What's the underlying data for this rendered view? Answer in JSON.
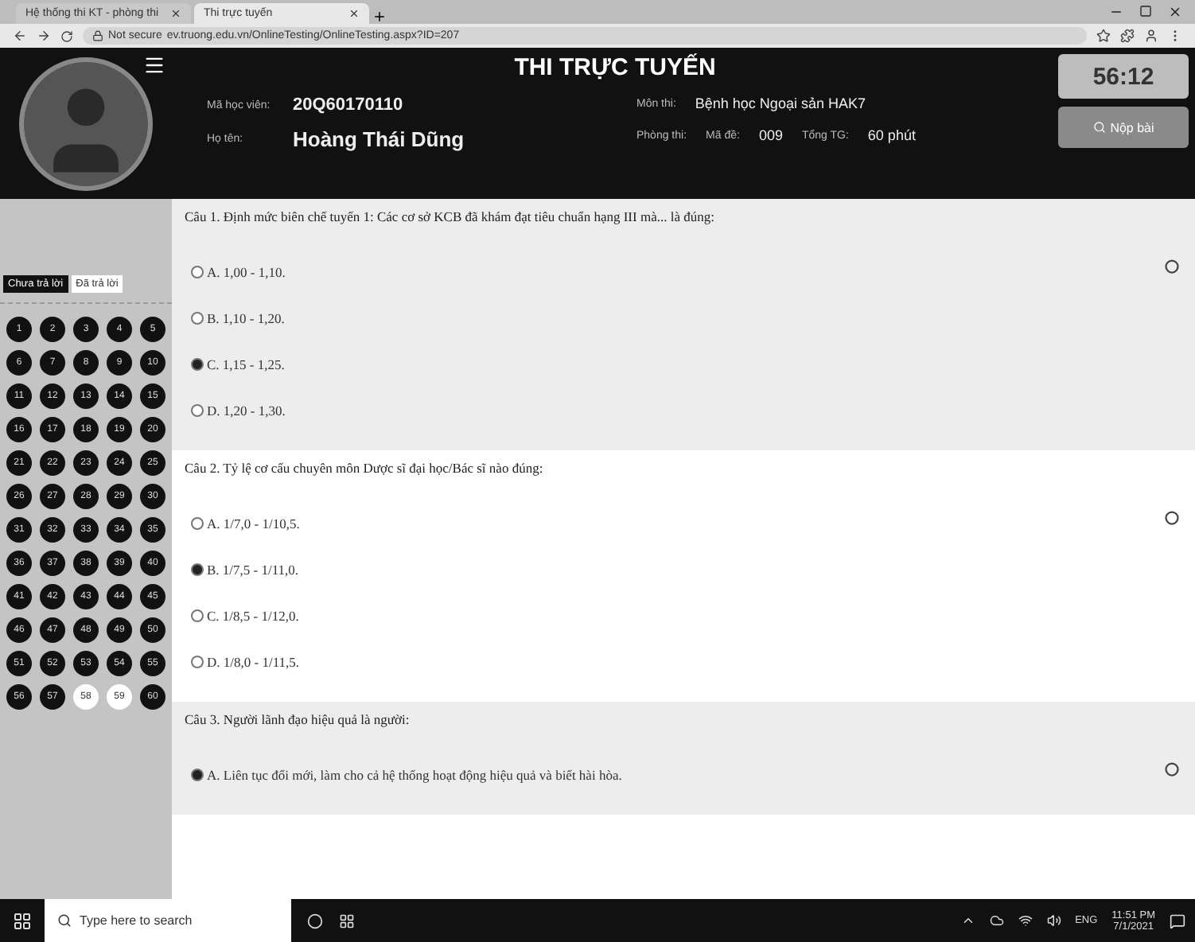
{
  "browser": {
    "tabs": [
      {
        "label": "Hệ thống thi KT - phòng thi",
        "selected": false
      },
      {
        "label": "Thi trực tuyến",
        "selected": true
      }
    ],
    "security": "Not secure",
    "url": "ev.truong.edu.vn/OnlineTesting/OnlineTesting.aspx?ID=207"
  },
  "header": {
    "title": "THI TRỰC TUYẾN",
    "fields": [
      {
        "label": "Mã học viên:",
        "value": "20Q60170110"
      },
      {
        "label": "Họ tên:",
        "value": "Hoàng Thái Dũng"
      }
    ],
    "exam": {
      "subject_label": "Môn thi:",
      "subject": "Bệnh học Ngoại sản HAK7",
      "room_label": "Phòng thi:",
      "code_label": "Mã đề:",
      "code": "009",
      "time_label": "Tổng TG:",
      "time": "60 phút"
    },
    "timer": "56:12",
    "submit": "Nộp bài"
  },
  "sidebar": {
    "tabs": [
      {
        "label": "Chưa trả lời",
        "selected": true
      },
      {
        "label": "Đã trả lời",
        "selected": false
      }
    ],
    "questions": [
      {
        "label": "1",
        "answered": true
      },
      {
        "label": "2",
        "answered": true
      },
      {
        "label": "3",
        "answered": true
      },
      {
        "label": "4",
        "answered": true
      },
      {
        "label": "5",
        "answered": true
      },
      {
        "label": "6",
        "answered": true
      },
      {
        "label": "7",
        "answered": true
      },
      {
        "label": "8",
        "answered": true
      },
      {
        "label": "9",
        "answered": true
      },
      {
        "label": "10",
        "answered": true
      },
      {
        "label": "11",
        "answered": true
      },
      {
        "label": "12",
        "answered": true
      },
      {
        "label": "13",
        "answered": true
      },
      {
        "label": "14",
        "answered": true
      },
      {
        "label": "15",
        "answered": true
      },
      {
        "label": "16",
        "answered": true
      },
      {
        "label": "17",
        "answered": true
      },
      {
        "label": "18",
        "answered": true
      },
      {
        "label": "19",
        "answered": true
      },
      {
        "label": "20",
        "answered": true
      },
      {
        "label": "21",
        "answered": true
      },
      {
        "label": "22",
        "answered": true
      },
      {
        "label": "23",
        "answered": true
      },
      {
        "label": "24",
        "answered": true
      },
      {
        "label": "25",
        "answered": true
      },
      {
        "label": "26",
        "answered": true
      },
      {
        "label": "27",
        "answered": true
      },
      {
        "label": "28",
        "answered": true
      },
      {
        "label": "29",
        "answered": true
      },
      {
        "label": "30",
        "answered": true
      },
      {
        "label": "31",
        "answered": true
      },
      {
        "label": "32",
        "answered": true
      },
      {
        "label": "33",
        "answered": true
      },
      {
        "label": "34",
        "answered": true
      },
      {
        "label": "35",
        "answered": true
      },
      {
        "label": "36",
        "answered": true
      },
      {
        "label": "37",
        "answered": true
      },
      {
        "label": "38",
        "answered": true
      },
      {
        "label": "39",
        "answered": true
      },
      {
        "label": "40",
        "answered": true
      },
      {
        "label": "41",
        "answered": true
      },
      {
        "label": "42",
        "answered": true
      },
      {
        "label": "43",
        "answered": true
      },
      {
        "label": "44",
        "answered": true
      },
      {
        "label": "45",
        "answered": true
      },
      {
        "label": "46",
        "answered": true
      },
      {
        "label": "47",
        "answered": true
      },
      {
        "label": "48",
        "answered": true
      },
      {
        "label": "49",
        "answered": true
      },
      {
        "label": "50",
        "answered": true
      },
      {
        "label": "51",
        "answered": true
      },
      {
        "label": "52",
        "answered": true
      },
      {
        "label": "53",
        "answered": true
      },
      {
        "label": "54",
        "answered": true
      },
      {
        "label": "55",
        "answered": true
      },
      {
        "label": "56",
        "answered": true
      },
      {
        "label": "57",
        "answered": true
      },
      {
        "label": "58",
        "answered": false
      },
      {
        "label": "59",
        "answered": false
      },
      {
        "label": "60",
        "answered": true
      }
    ]
  },
  "questions": [
    {
      "text": "Câu 1. Định mức biên chế tuyến 1: Các cơ sở KCB đã khám đạt tiêu chuẩn hạng III mà... là đúng:",
      "options": [
        {
          "label": "A. 1,00 - 1,10.",
          "selected": false
        },
        {
          "label": "B. 1,10 - 1,20.",
          "selected": false
        },
        {
          "label": "C. 1,15 - 1,25.",
          "selected": true
        },
        {
          "label": "D. 1,20 - 1,30.",
          "selected": false
        }
      ]
    },
    {
      "text": "Câu 2. Tỷ lệ cơ cấu chuyên môn Dược sĩ đại học/Bác sĩ nào đúng:",
      "options": [
        {
          "label": "A. 1/7,0 - 1/10,5.",
          "selected": false
        },
        {
          "label": "B. 1/7,5 - 1/11,0.",
          "selected": true
        },
        {
          "label": "C. 1/8,5 - 1/12,0.",
          "selected": false
        },
        {
          "label": "D. 1/8,0 - 1/11,5.",
          "selected": false
        }
      ]
    },
    {
      "text": "Câu 3. Người lãnh đạo hiệu quả là người:",
      "options": [
        {
          "label": "A. Liên tục đổi mới, làm cho cả hệ thống hoạt động hiệu quả và biết hài hòa.",
          "selected": true
        }
      ]
    }
  ],
  "taskbar": {
    "search_placeholder": "Type here to search",
    "language": "ENG",
    "time": "11:51 PM",
    "date": "7/1/2021"
  }
}
